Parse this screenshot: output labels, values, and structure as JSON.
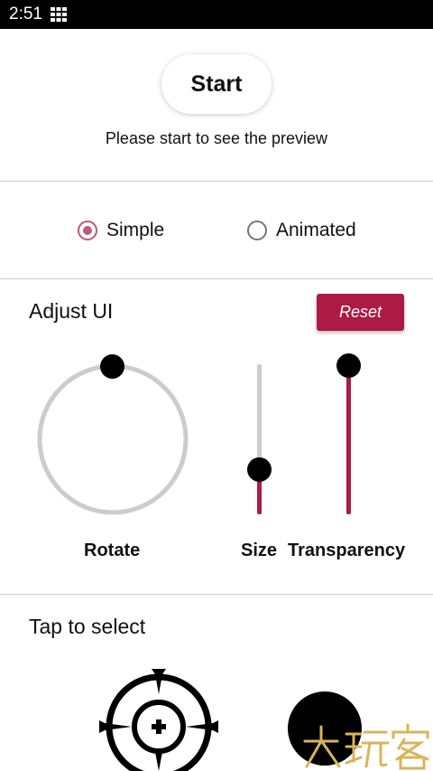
{
  "status_bar": {
    "time": "2:51",
    "grid_icon": "apps-grid-icon"
  },
  "header": {
    "start_label": "Start",
    "preview_hint": "Please start to see the preview"
  },
  "mode": {
    "options": [
      {
        "label": "Simple",
        "checked": true
      },
      {
        "label": "Animated",
        "checked": false
      }
    ]
  },
  "adjust": {
    "title": "Adjust UI",
    "reset_label": "Reset",
    "rotate_label": "Rotate",
    "size_label": "Size",
    "transparency_label": "Transparency",
    "size_level": 0.25,
    "transparency_level": 1.0
  },
  "select": {
    "title": "Tap to select",
    "items": [
      "crosshair-icon",
      "black-circle-icon"
    ]
  },
  "watermark": {
    "text": "大玩客"
  },
  "colors": {
    "accent": "#ab1b44",
    "radio": "#c0587a",
    "track": "#cccccc",
    "divider": "#cfcfcf"
  }
}
